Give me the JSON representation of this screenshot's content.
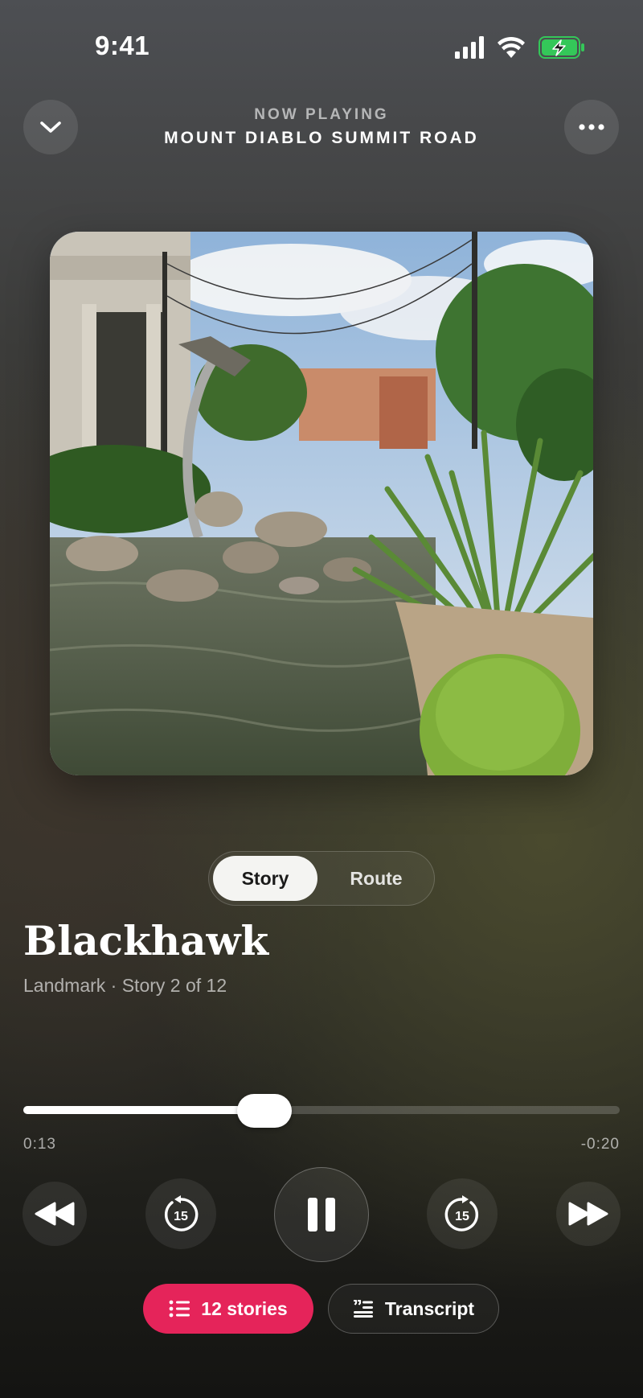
{
  "status_bar": {
    "time": "9:41",
    "signal_icon": "cellular-signal-icon",
    "wifi_icon": "wifi-icon",
    "battery_icon": "battery-charging-icon",
    "battery_color": "#34c759"
  },
  "header": {
    "kicker": "NOW PLAYING",
    "title": "MOUNT DIABLO SUMMIT ROAD",
    "collapse_icon": "chevron-down-icon",
    "more_icon": "ellipsis-icon"
  },
  "artwork": {
    "subject_icon": "photo-landmark-fountain"
  },
  "segmented": {
    "options": [
      "Story",
      "Route"
    ],
    "selected": "Story"
  },
  "story": {
    "title": "Blackhawk",
    "subtitle": "Landmark · Story 2 of 12"
  },
  "scrubber": {
    "progress_fraction": 0.404,
    "elapsed": "0:13",
    "remaining": "-0:20"
  },
  "transport": {
    "rewind_icon": "rewind-icon",
    "skip_back_icon": "skip-back-15-icon",
    "skip_back_seconds": "15",
    "play_pause_icon": "pause-icon",
    "skip_forward_icon": "skip-forward-15-icon",
    "skip_forward_seconds": "15",
    "fast_forward_icon": "fast-forward-icon"
  },
  "actions": {
    "stories_label": "12 stories",
    "stories_icon": "list-icon",
    "stories_color": "#e5245a",
    "transcript_label": "Transcript",
    "transcript_icon": "transcript-icon"
  }
}
